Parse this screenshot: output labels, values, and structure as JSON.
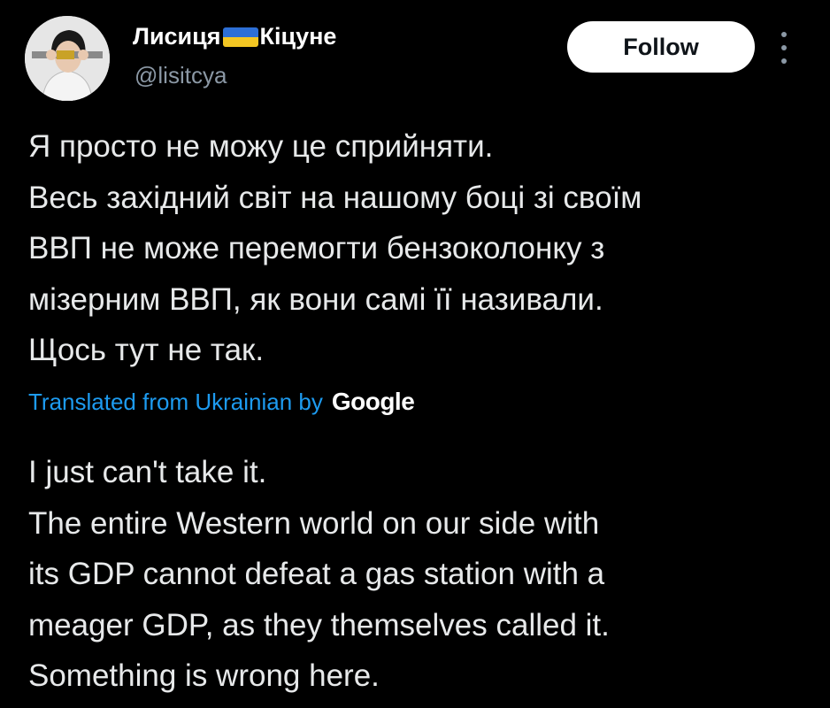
{
  "author": {
    "name_part1": "Лисиця",
    "name_part2": "Кіцуне",
    "handle": "@lisitcya",
    "flag_colors": [
      "#2d6fd6",
      "#f3c623"
    ]
  },
  "actions": {
    "follow_label": "Follow",
    "more_icon": "more-vertical-icon"
  },
  "tweet": {
    "original_lines": [
      "Я просто не можу це сприйняти.",
      "Весь західний світ на нашому боці зі своїм",
      "ВВП не може перемогти бензоколонку з",
      "мізерним ВВП, як вони самі її називали.",
      "Щось тут не так."
    ],
    "translation_note": "Translated from Ukrainian by",
    "translation_provider": "Google",
    "translated_lines": [
      "I just can't take it.",
      "The entire Western world on our side with",
      "its GDP cannot defeat a gas station with a",
      "meager GDP, as they themselves called it.",
      "Something is wrong here."
    ]
  },
  "colors": {
    "background": "#000000",
    "text": "#e7e9ea",
    "secondary": "#8b98a5",
    "link": "#1d9bf0"
  }
}
